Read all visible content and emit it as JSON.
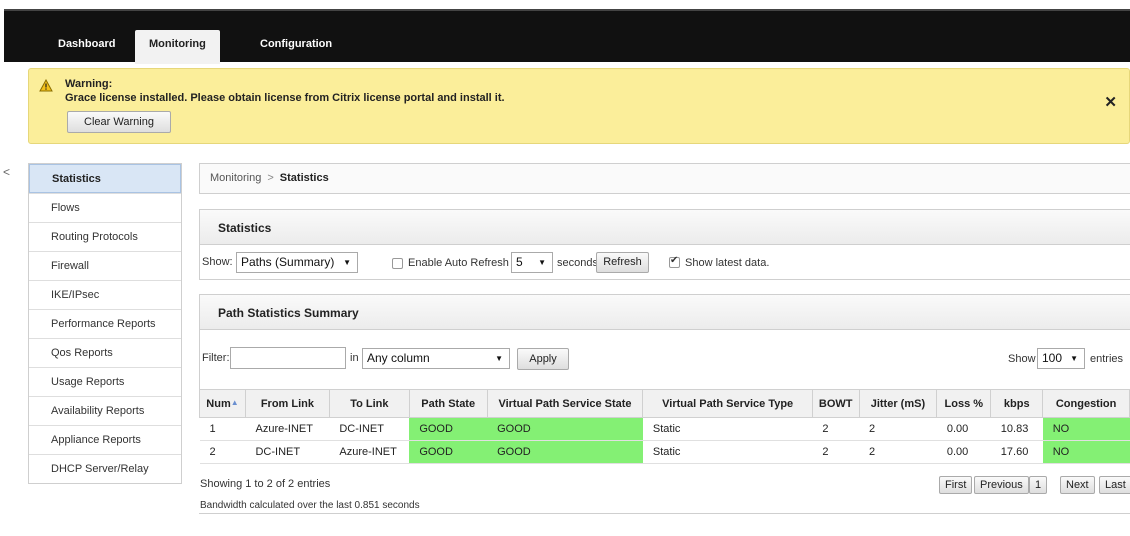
{
  "nav": {
    "tabs": [
      {
        "label": "Dashboard",
        "active": false
      },
      {
        "label": "Monitoring",
        "active": true
      },
      {
        "label": "Configuration",
        "active": false
      }
    ]
  },
  "warning": {
    "title": "Warning:",
    "message": "Grace license installed. Please obtain license from Citrix license portal and install it.",
    "clear_label": "Clear Warning",
    "close_glyph": "✕",
    "icon": "warning-triangle-icon"
  },
  "sidebar": {
    "items": [
      {
        "label": "Statistics",
        "active": true
      },
      {
        "label": "Flows"
      },
      {
        "label": "Routing Protocols"
      },
      {
        "label": "Firewall"
      },
      {
        "label": "IKE/IPsec"
      },
      {
        "label": "Performance Reports"
      },
      {
        "label": "Qos Reports"
      },
      {
        "label": "Usage Reports"
      },
      {
        "label": "Availability Reports"
      },
      {
        "label": "Appliance Reports"
      },
      {
        "label": "DHCP Server/Relay"
      }
    ]
  },
  "breadcrumb": {
    "parent": "Monitoring",
    "separator": ">",
    "current": "Statistics"
  },
  "statistics_panel": {
    "title": "Statistics",
    "show_label": "Show:",
    "show_value": "Paths (Summary)",
    "auto_refresh_label": "Enable Auto Refresh",
    "auto_refresh_checked": false,
    "interval_value": "5",
    "seconds_label": "seconds",
    "refresh_label": "Refresh",
    "latest_label": "Show latest data.",
    "latest_checked": true
  },
  "summary_panel": {
    "title": "Path Statistics Summary",
    "filter_label": "Filter:",
    "filter_value": "",
    "in_label": "in",
    "column_value": "Any column",
    "apply_label": "Apply",
    "show_label": "Show",
    "entries_value": "100",
    "entries_label": "entries"
  },
  "table": {
    "columns": [
      "Num",
      "From Link",
      "To Link",
      "Path State",
      "Virtual Path Service State",
      "Virtual Path Service Type",
      "BOWT",
      "Jitter (mS)",
      "Loss %",
      "kbps",
      "Congestion"
    ],
    "rows": [
      [
        "1",
        "Azure-INET",
        "DC-INET",
        "GOOD",
        "GOOD",
        "Static",
        "2",
        "2",
        "0.00",
        "10.83",
        "NO"
      ],
      [
        "2",
        "DC-INET",
        "Azure-INET",
        "GOOD",
        "GOOD",
        "Static",
        "2",
        "2",
        "0.00",
        "17.60",
        "NO"
      ]
    ],
    "status_colors": {
      "good": "#84f074"
    }
  },
  "footer": {
    "showing": "Showing 1 to 2 of 2 entries",
    "pagination": [
      "First",
      "Previous",
      "1",
      "Next",
      "Last"
    ],
    "bandwidth_note": "Bandwidth calculated over the last 0.851 seconds"
  }
}
